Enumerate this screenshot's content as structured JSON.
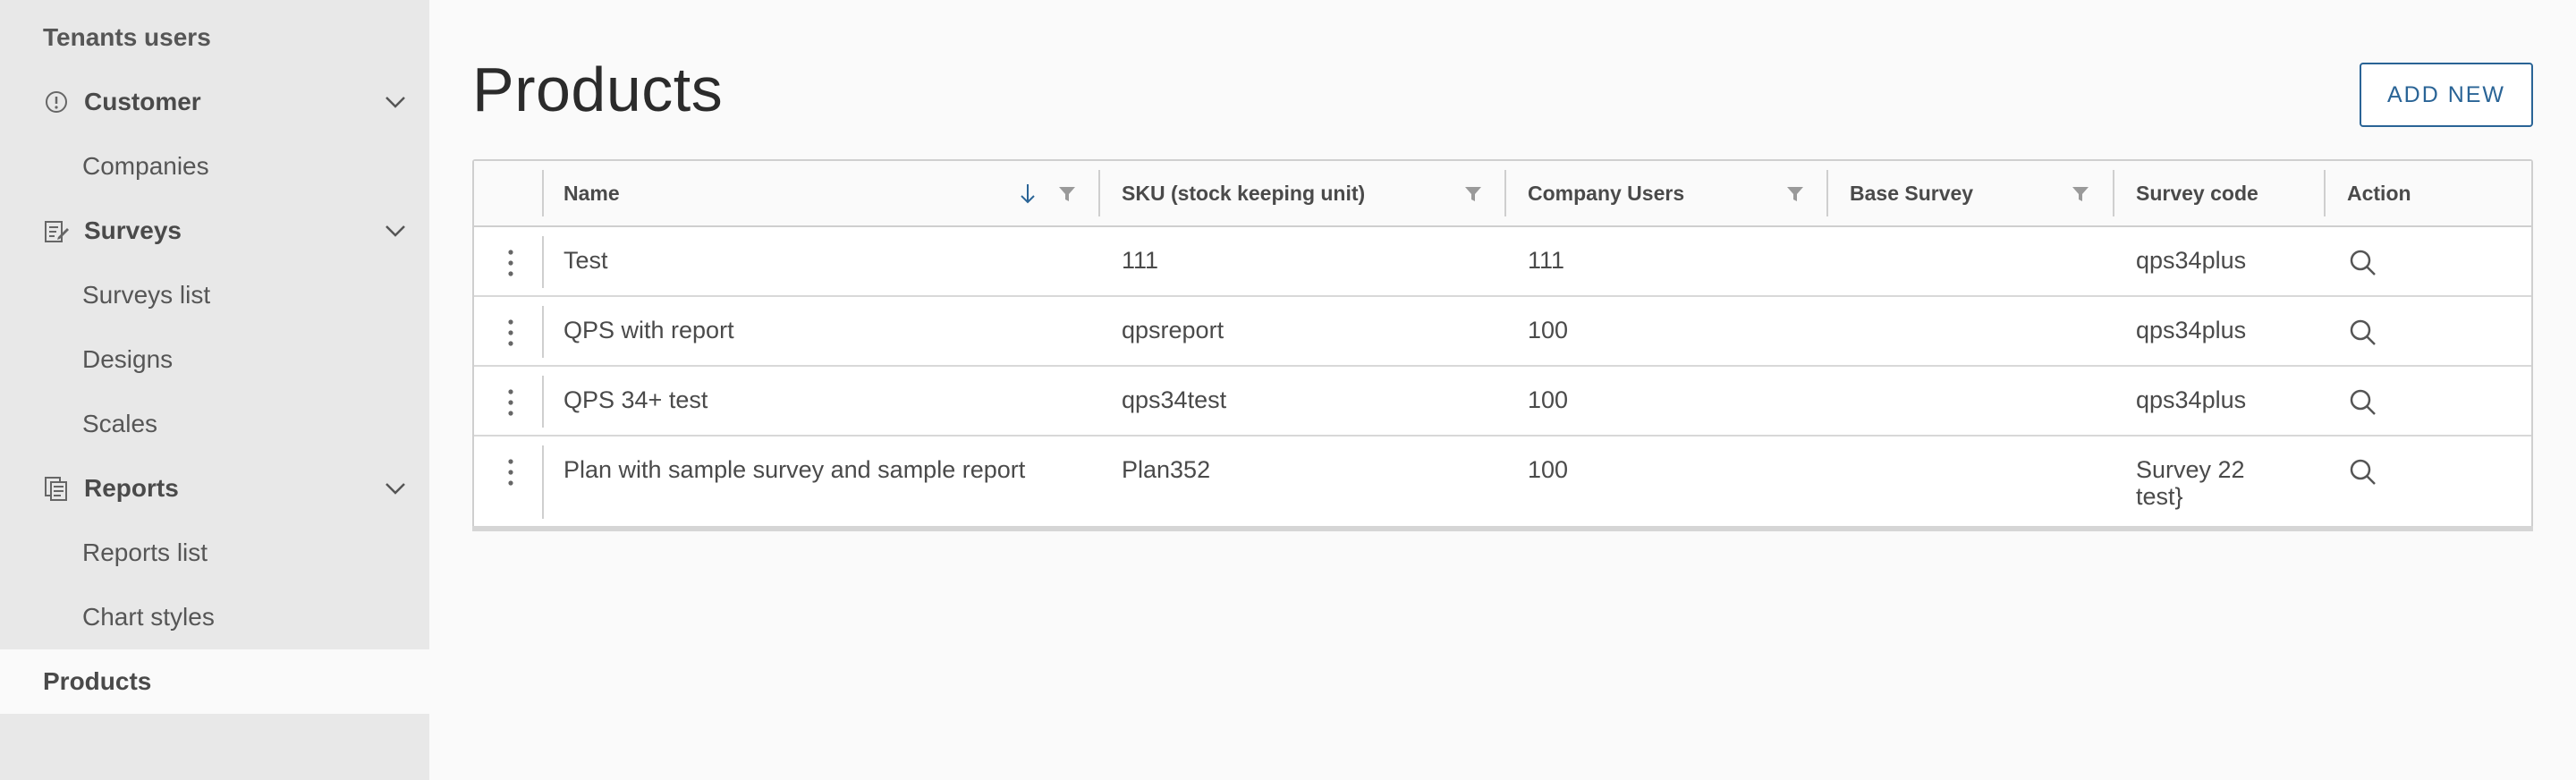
{
  "sidebar": {
    "tenants_users": "Tenants users",
    "customer": "Customer",
    "companies": "Companies",
    "surveys": "Surveys",
    "surveys_list": "Surveys list",
    "designs": "Designs",
    "scales": "Scales",
    "reports": "Reports",
    "reports_list": "Reports list",
    "chart_styles": "Chart styles",
    "products": "Products"
  },
  "page": {
    "title": "Products",
    "add_new": "ADD NEW"
  },
  "table": {
    "columns": {
      "name": "Name",
      "sku": "SKU (stock keeping unit)",
      "company_users": "Company Users",
      "base_survey": "Base Survey",
      "survey_code": "Survey code",
      "action": "Action"
    },
    "rows": [
      {
        "name": "Test",
        "sku": "111",
        "company_users": "111",
        "base_survey": "",
        "survey_code": "qps34plus"
      },
      {
        "name": "QPS with report",
        "sku": "qpsreport",
        "company_users": "100",
        "base_survey": "",
        "survey_code": "qps34plus"
      },
      {
        "name": "QPS 34+ test",
        "sku": "qps34test",
        "company_users": "100",
        "base_survey": "",
        "survey_code": "qps34plus"
      },
      {
        "name": "Plan with sample survey and sample report",
        "sku": "Plan352",
        "company_users": "100",
        "base_survey": "",
        "survey_code": "Survey 22 test}"
      }
    ]
  },
  "colors": {
    "accent": "#2a6496",
    "sidebar_bg": "#e8e8e8",
    "page_bg": "#fafafa"
  }
}
